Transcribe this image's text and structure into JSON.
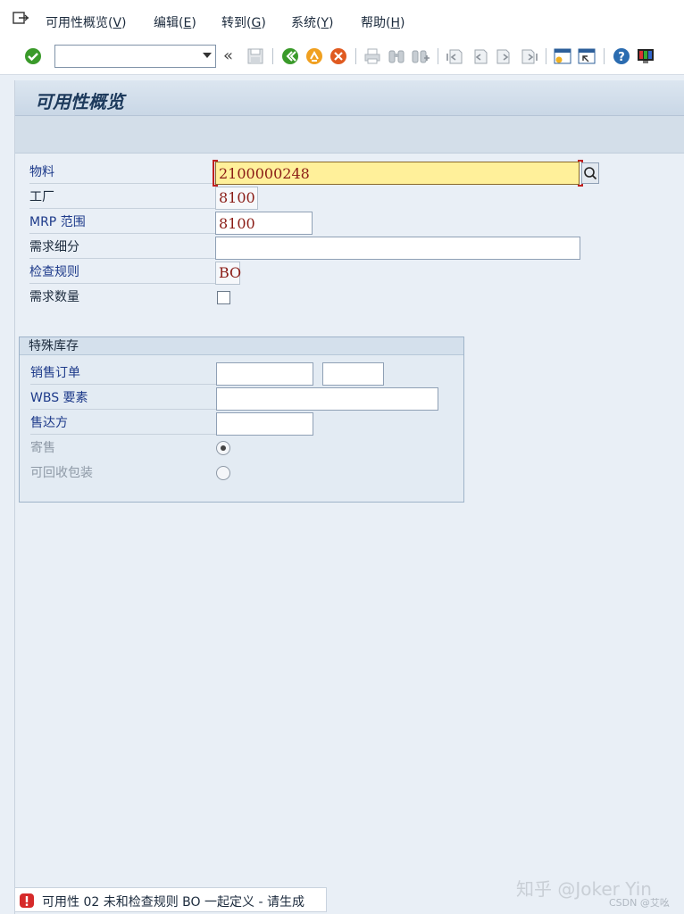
{
  "menu": {
    "items": [
      {
        "label": "可用性概览",
        "key": "V"
      },
      {
        "label": "编辑",
        "key": "E"
      },
      {
        "label": "转到",
        "key": "G"
      },
      {
        "label": "系统",
        "key": "Y"
      },
      {
        "label": "帮助",
        "key": "H"
      }
    ]
  },
  "toolbar": {
    "command_value": "",
    "icons": [
      "enter-icon",
      "save-icon",
      "back-icon",
      "exit-icon",
      "cancel-icon",
      "print-icon",
      "find-icon",
      "find-next-icon",
      "first-page-icon",
      "previous-page-icon",
      "next-page-icon",
      "last-page-icon",
      "create-session-icon",
      "shortcut-icon",
      "help-icon",
      "layout-menu-icon"
    ]
  },
  "screen": {
    "title": "可用性概览"
  },
  "form": {
    "material": {
      "label": "物料",
      "value": "2100000248"
    },
    "plant": {
      "label": "工厂",
      "value": "8100"
    },
    "mrp_area": {
      "label": "MRP 范围",
      "value": "8100"
    },
    "requirement_segment": {
      "label": "需求细分",
      "value": ""
    },
    "checking_rule": {
      "label": "检查规则",
      "value": "BO"
    },
    "requirement_quantity": {
      "label": "需求数量",
      "checked": false
    }
  },
  "special_stock": {
    "title": "特殊库存",
    "sales_order": {
      "label": "销售订单",
      "value": "",
      "item": ""
    },
    "wbs_element": {
      "label": "WBS 要素",
      "value": ""
    },
    "sold_to": {
      "label": "售达方",
      "value": ""
    },
    "consignment": {
      "label": "寄售",
      "selected": true
    },
    "returnable_packaging": {
      "label": "可回收包装",
      "selected": false
    }
  },
  "status": {
    "type": "error",
    "message": "可用性 02 未和检查规则 BO 一起定义 - 请生成"
  },
  "watermark": {
    "main": "知乎 @Joker Yin",
    "sub": "CSDN @艾吆"
  },
  "colors": {
    "accent": "#1d3a5c",
    "highlight": "#fff09a",
    "error": "#d62a2a",
    "value_text": "#8a1c16"
  }
}
